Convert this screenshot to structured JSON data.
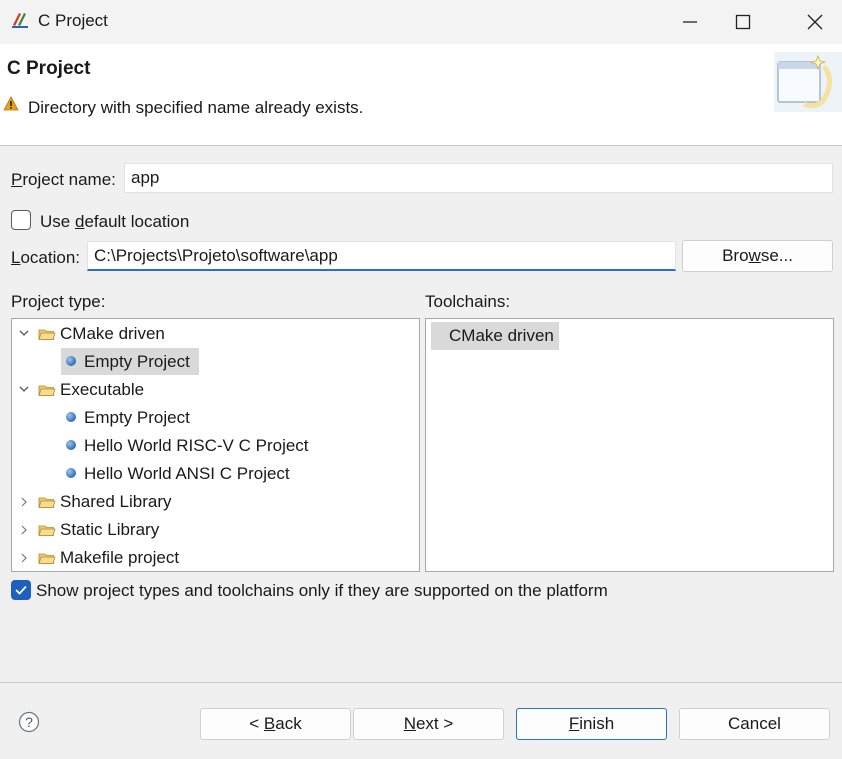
{
  "window": {
    "title": "C Project"
  },
  "header": {
    "title": "C Project",
    "message": "Directory with specified name already exists."
  },
  "form": {
    "project_name_label": "Project name:",
    "project_name_value": "app",
    "use_default_location_label": "Use default location",
    "use_default_location_checked": false,
    "location_label": "Location:",
    "location_value": "C:\\Projects\\Projeto\\software\\app",
    "browse_label": "Browse..."
  },
  "project_types": {
    "label": "Project type:",
    "items": [
      {
        "label": "CMake driven",
        "kind": "folder",
        "expanded": true,
        "depth": 0
      },
      {
        "label": "Empty Project",
        "kind": "leaf",
        "selected": true,
        "depth": 1
      },
      {
        "label": "Executable",
        "kind": "folder",
        "expanded": true,
        "depth": 0
      },
      {
        "label": "Empty Project",
        "kind": "leaf",
        "depth": 1
      },
      {
        "label": "Hello World RISC-V C Project",
        "kind": "leaf",
        "depth": 1
      },
      {
        "label": "Hello World ANSI C Project",
        "kind": "leaf",
        "depth": 1
      },
      {
        "label": "Shared Library",
        "kind": "folder",
        "expanded": false,
        "depth": 0
      },
      {
        "label": "Static Library",
        "kind": "folder",
        "expanded": false,
        "depth": 0
      },
      {
        "label": "Makefile project",
        "kind": "folder",
        "expanded": false,
        "depth": 0
      }
    ]
  },
  "toolchains": {
    "label": "Toolchains:",
    "items": [
      "CMake driven"
    ]
  },
  "show_supported": {
    "label": "Show project types and toolchains only if they are supported on the platform",
    "checked": true
  },
  "footer": {
    "back_label": "< Back",
    "next_label": "Next >",
    "finish_label": "Finish",
    "cancel_label": "Cancel"
  },
  "colors": {
    "accent": "#1f5fbf",
    "warning": "#e8a317",
    "selection": "#d9d9d9"
  }
}
